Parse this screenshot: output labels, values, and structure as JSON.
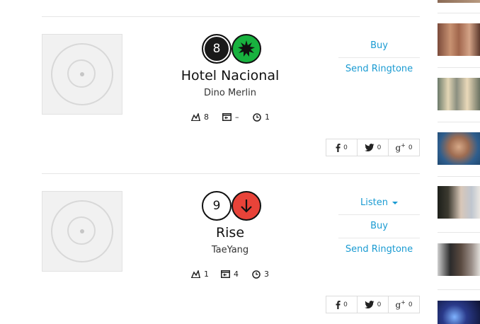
{
  "entries": [
    {
      "rank": "8",
      "title": "Hotel Nacional",
      "artist": "Dino Merlin",
      "stats": {
        "peak": "8",
        "weeks_label": "–",
        "time": "1"
      },
      "actions": {
        "buy": "Buy",
        "send": "Send Ringtone"
      },
      "share": {
        "facebook": "0",
        "twitter": "0",
        "gplus": "0"
      },
      "movement": "new",
      "rank_style": "dark"
    },
    {
      "rank": "9",
      "title": "Rise",
      "artist": "TaeYang",
      "stats": {
        "peak": "1",
        "weeks_label": "4",
        "time": "3"
      },
      "actions": {
        "listen": "Listen",
        "buy": "Buy",
        "send": "Send Ringtone"
      },
      "share": {
        "facebook": "0",
        "twitter": "0",
        "gplus": "0"
      },
      "movement": "down",
      "rank_style": "light"
    }
  ],
  "colors": {
    "accent": "#1a9bd2",
    "new": "#18b23f",
    "down": "#e84339"
  },
  "sidebar": {
    "thumbnails": [
      "thumb-photo-1",
      "thumb-photo-2",
      "thumb-photo-3",
      "thumb-photo-4",
      "thumb-photo-5",
      "thumb-photo-6",
      "thumb-photo-7"
    ]
  }
}
